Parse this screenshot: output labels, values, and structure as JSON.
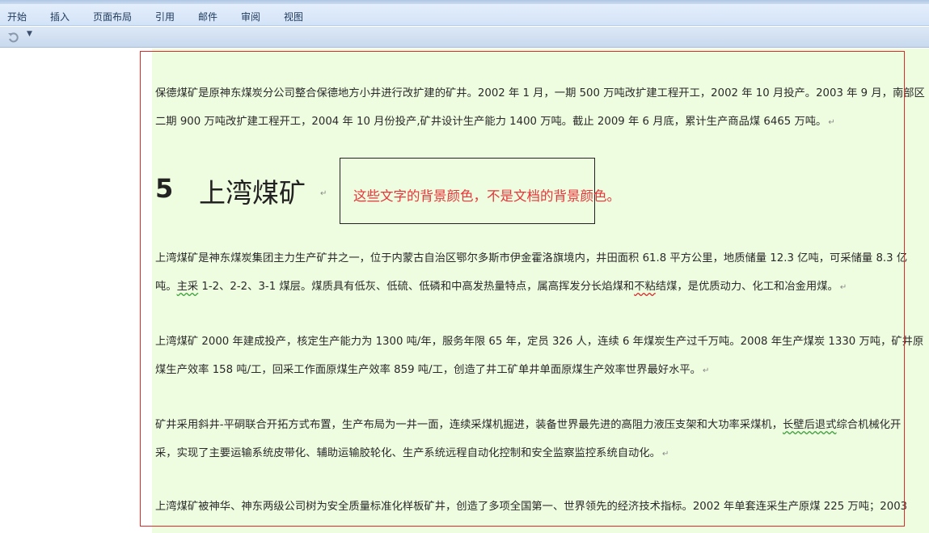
{
  "menu": [
    {
      "id": "home",
      "label": "开始"
    },
    {
      "id": "insert",
      "label": "插入"
    },
    {
      "id": "page-layout",
      "label": "页面布局"
    },
    {
      "id": "references",
      "label": "引用"
    },
    {
      "id": "mailings",
      "label": "邮件"
    },
    {
      "id": "review",
      "label": "审阅"
    },
    {
      "id": "view",
      "label": "视图"
    }
  ],
  "qat": {
    "undo_icon": "undo-icon",
    "more_icon": "dropdown-arrow-icon"
  },
  "document": {
    "p1": {
      "line1": "保德煤矿是原神东煤炭分公司整合保德地方小井进行改扩建的矿井。2002 年 1 月，一期 500 万吨改扩建工程开工，2002 年 10 月投产。2003 年 9 月，南部区",
      "line2": "二期 900 万吨改扩建工程开工，2004 年 10 月份投产,矿井设计生产能力 1400 万吨。截止 2009 年 6 月底，累计生产商品煤 6465 万吨。"
    },
    "heading": {
      "number": "5",
      "text": "上湾煤矿"
    },
    "callout": "这些文字的背景颜色，不是文档的背景颜色。",
    "p2": {
      "line1": "上湾煤矿是神东煤炭集团主力生产矿井之一，位于内蒙古自治区鄂尔多斯市伊金霍洛旗境内，井田面积 61.8 平方公里，地质储量 12.3 亿吨，可采储量 8.3 亿",
      "line2_a": "吨。",
      "line2_b": "主采",
      "line2_c": " 1-2、2-2、3-1 煤层。煤质具有低灰、低硫、低磷和中高发热量特点，属高挥发分长焰煤和",
      "line2_d": "不粘",
      "line2_e": "结煤，是优质动力、化工和冶金用煤。"
    },
    "p3": {
      "line1": "上湾煤矿 2000 年建成投产，核定生产能力为 1300 吨/年，服务年限 65 年，定员 326 人，连续 6 年煤炭生产过千万吨。2008 年生产煤炭 1330 万吨，矿井原",
      "line2": "煤生产效率 158 吨/工，回采工作面原煤生产效率 859 吨/工，创造了井工矿单井单面原煤生产效率世界最好水平。"
    },
    "p4": {
      "line1_a": "矿井采用斜井-平硐联合开拓方式布置，生产布局为一井一面，连续采煤机掘进，装备世界最先进的高阻力液压支架和大功率采煤机，",
      "line1_b": "长壁后退式",
      "line1_c": "综合机械化开",
      "line2": "采，实现了主要运输系统皮带化、辅助运输胶轮化、生产系统远程自动化控制和安全监察监控系统自动化。"
    },
    "p5": {
      "line1": "上湾煤矿被神华、神东两级公司树为安全质量标准化样板矿井，创造了多项全国第一、世界领先的经济技术指标。2002 年单套连采生产原煤 225 万吨；2003"
    },
    "paragraph_mark": "↵"
  }
}
